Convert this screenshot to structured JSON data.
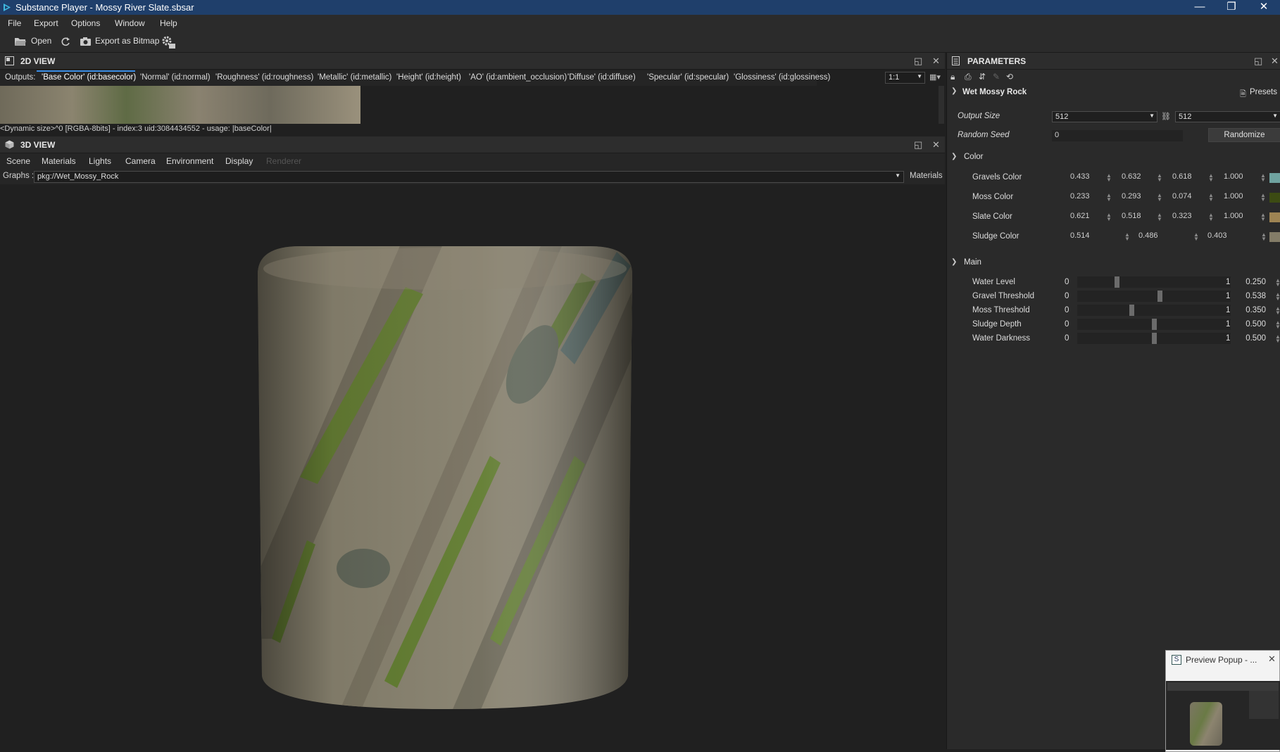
{
  "window": {
    "title": "Substance Player - Mossy River Slate.sbsar",
    "minimize_glyph": "—",
    "restore_glyph": "❐",
    "close_glyph": "✕"
  },
  "menu": [
    "File",
    "Export",
    "Options",
    "Window",
    "Help"
  ],
  "toolbar": {
    "open_label": "Open",
    "export_label": "Export as Bitmap",
    "icons": [
      "folder-open-icon",
      "refresh-icon",
      "camera-icon",
      "settings-gear-icon"
    ]
  },
  "view2d": {
    "title": "2D VIEW",
    "outputs_label": "Outputs:",
    "outputs": [
      "'Base Color' (id:basecolor)",
      "'Normal' (id:normal)",
      "'Roughness' (id:roughness)",
      "'Metallic' (id:metallic)",
      "'Height' (id:height)",
      "'AO' (id:ambient_occlusion)",
      "'Diffuse' (id:diffuse)",
      "'Specular' (id:specular)",
      "'Glossiness' (id:glossiness)"
    ],
    "zoom": "1:1",
    "status": "<Dynamic size>^0 [RGBA-8bits] - index:3 uid:3084434552 - usage: |baseColor|"
  },
  "view3d": {
    "title": "3D VIEW",
    "menu": [
      "Scene",
      "Materials",
      "Lights",
      "Camera",
      "Environment",
      "Display",
      "Renderer"
    ],
    "graphs_label": "Graphs :",
    "graph_value": "pkg://Wet_Mossy_Rock",
    "materials_label": "Materials"
  },
  "parameters": {
    "title": "PARAMETERS",
    "graph_name": "Wet Mossy Rock",
    "presets_label": "Presets",
    "output_size_label": "Output Size",
    "output_size_w": "512",
    "output_size_h": "512",
    "random_seed_label": "Random Seed",
    "random_seed_value": "0",
    "randomize_label": "Randomize",
    "color_group": "Color",
    "colors": [
      {
        "label": "Gravels Color",
        "r": "0.433",
        "g": "0.632",
        "b": "0.618",
        "a": "1.000",
        "swatch": "#6fa3a0"
      },
      {
        "label": "Moss Color",
        "r": "0.233",
        "g": "0.293",
        "b": "0.074",
        "a": "1.000",
        "swatch": "#3c4b13"
      },
      {
        "label": "Slate Color",
        "r": "0.621",
        "g": "0.518",
        "b": "0.323",
        "a": "1.000",
        "swatch": "#9e8453"
      },
      {
        "label": "Sludge Color",
        "r": "0.514",
        "g": "0.486",
        "b": "0.403",
        "a": "",
        "swatch": "#837c67"
      }
    ],
    "main_group": "Main",
    "sliders": [
      {
        "label": "Water Level",
        "min": "0",
        "max": "1",
        "value": "0.250",
        "fraction": 0.25
      },
      {
        "label": "Gravel Threshold",
        "min": "0",
        "max": "1",
        "value": "0.538",
        "fraction": 0.538
      },
      {
        "label": "Moss Threshold",
        "min": "0",
        "max": "1",
        "value": "0.350",
        "fraction": 0.35
      },
      {
        "label": "Sludge Depth",
        "min": "0",
        "max": "1",
        "value": "0.500",
        "fraction": 0.5
      },
      {
        "label": "Water Darkness",
        "min": "0",
        "max": "1",
        "value": "0.500",
        "fraction": 0.5
      }
    ]
  },
  "preview_popup": {
    "title": "Preview Popup - ..."
  }
}
